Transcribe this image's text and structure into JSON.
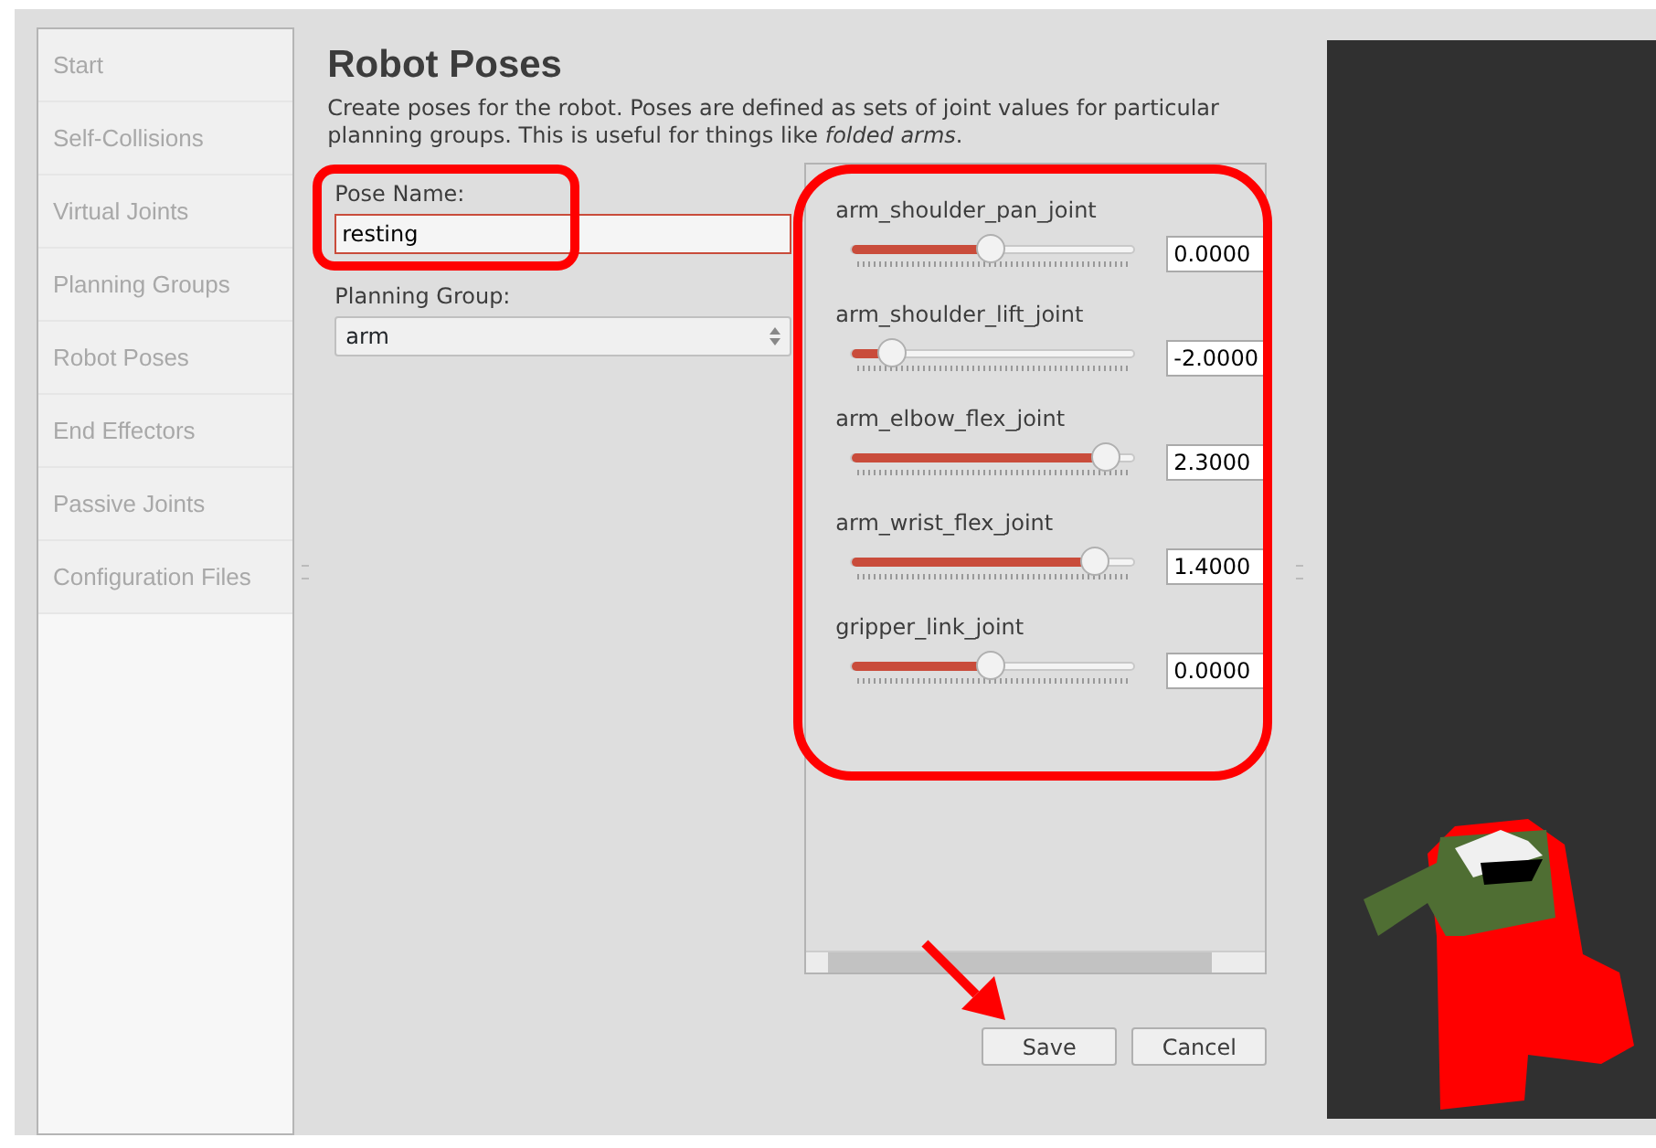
{
  "sidebar": {
    "items": [
      {
        "label": "Start"
      },
      {
        "label": "Self-Collisions"
      },
      {
        "label": "Virtual Joints"
      },
      {
        "label": "Planning Groups"
      },
      {
        "label": "Robot Poses"
      },
      {
        "label": "End Effectors"
      },
      {
        "label": "Passive Joints"
      },
      {
        "label": "Configuration Files"
      }
    ]
  },
  "page": {
    "title": "Robot Poses",
    "description": "Create poses for the robot. Poses are defined as sets of joint values for particular planning groups. This is useful for things like *folded arms*."
  },
  "form": {
    "pose_name": {
      "label": "Pose Name:",
      "value": "resting"
    },
    "planning_group": {
      "label": "Planning Group:",
      "value": "arm"
    }
  },
  "joints": [
    {
      "name": "arm_shoulder_pan_joint",
      "level": 0.49,
      "value": "0.0000"
    },
    {
      "name": "arm_shoulder_lift_joint",
      "level": 0.14,
      "value": "-2.0000"
    },
    {
      "name": "arm_elbow_flex_joint",
      "level": 0.9,
      "value": "2.3000"
    },
    {
      "name": "arm_wrist_flex_joint",
      "level": 0.86,
      "value": "1.4000"
    },
    {
      "name": "gripper_link_joint",
      "level": 0.49,
      "value": "0.0000"
    }
  ],
  "buttons": [
    "Save",
    "Cancel"
  ]
}
